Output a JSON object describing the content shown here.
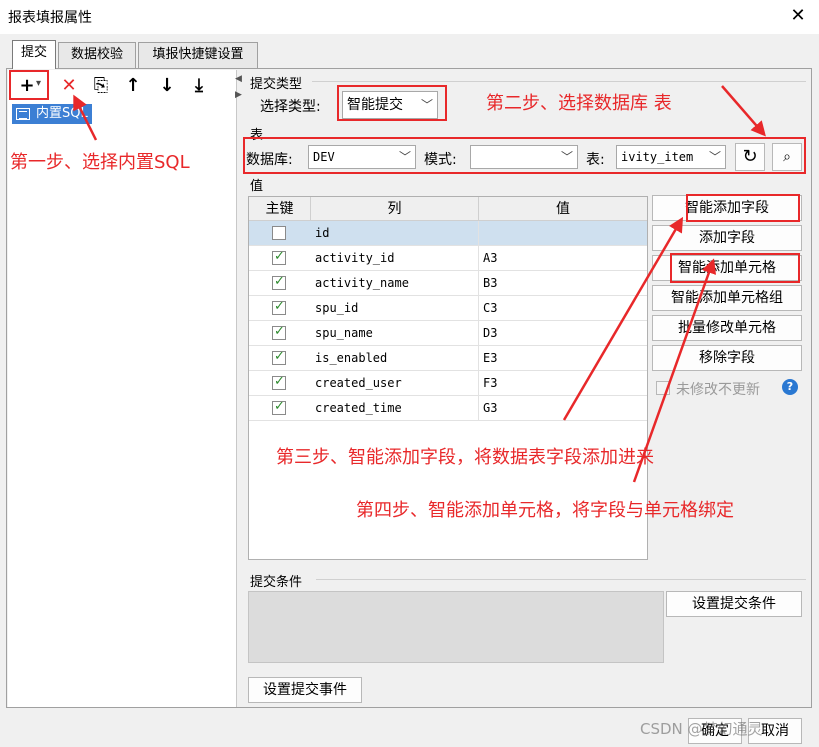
{
  "window": {
    "title": "报表填报属性",
    "close": "✕"
  },
  "tabs": [
    {
      "label": "提交"
    },
    {
      "label": "数据校验"
    },
    {
      "label": "填报快捷键设置"
    }
  ],
  "toolbar": {
    "add": "+",
    "add_dropdown": "▾",
    "delete": "✕",
    "copy": "⎘",
    "up": "↑",
    "down": "↓",
    "bottom": "⤓"
  },
  "tree": {
    "item": "内置SQL"
  },
  "submit_type": {
    "section": "提交类型",
    "label": "选择类型:",
    "value": "智能提交"
  },
  "table_section": {
    "section": "表",
    "db_label": "数据库:",
    "db_value": "DEV",
    "mode_label": "模式:",
    "mode_value": "",
    "table_label": "表:",
    "table_value": "ivity_item"
  },
  "value_section": {
    "section": "值",
    "headers": [
      "主键",
      "列",
      "值"
    ],
    "rows": [
      {
        "checked": false,
        "column": "id",
        "value": ""
      },
      {
        "checked": true,
        "column": "activity_id",
        "value": "A3"
      },
      {
        "checked": true,
        "column": "activity_name",
        "value": "B3"
      },
      {
        "checked": true,
        "column": "spu_id",
        "value": "C3"
      },
      {
        "checked": true,
        "column": "spu_name",
        "value": "D3"
      },
      {
        "checked": true,
        "column": "is_enabled",
        "value": "E3"
      },
      {
        "checked": true,
        "column": "created_user",
        "value": "F3"
      },
      {
        "checked": true,
        "column": "created_time",
        "value": "G3"
      }
    ]
  },
  "side_buttons": {
    "smart_add_field": "智能添加字段",
    "add_field": "添加字段",
    "smart_add_cell": "智能添加单元格",
    "smart_add_cell_group": "智能添加单元格组",
    "batch_modify_cell": "批量修改单元格",
    "remove_field": "移除字段",
    "no_update_unmodified": "未修改不更新",
    "help": "?"
  },
  "submit_condition": {
    "section": "提交条件",
    "button": "设置提交条件"
  },
  "submit_event": {
    "button": "设置提交事件"
  },
  "footer": {
    "ok": "确定",
    "cancel": "取消",
    "watermark": "CSDN @梦幻通灵"
  },
  "annotations": {
    "step1": "第一步、选择内置SQL",
    "step2": "第二步、选择数据库 表",
    "step3": "第三步、智能添加字段，将数据表字段添加进来",
    "step4": "第四步、智能添加单元格，将字段与单元格绑定"
  },
  "colors": {
    "annotation": "#e8282a",
    "selection": "#3c7fd4",
    "check": "#2e8b2e"
  }
}
